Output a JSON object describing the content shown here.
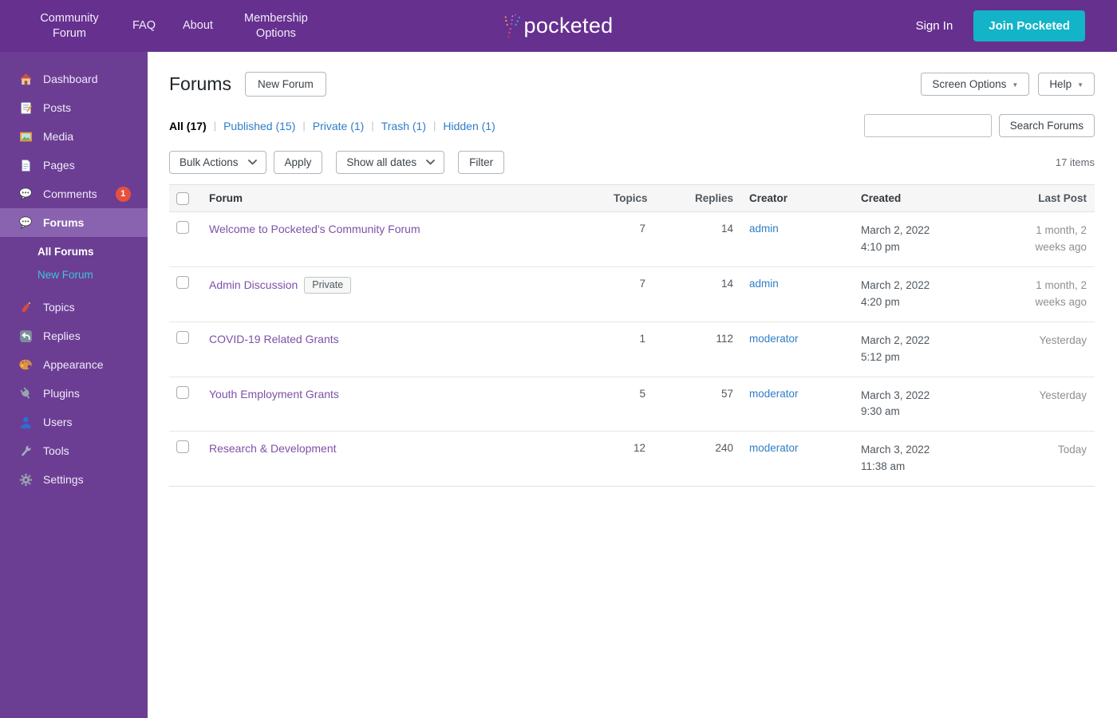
{
  "colors": {
    "topbar_purple": "#66308f",
    "sidebar_purple": "#6b3e94",
    "active_item_purple": "#8a63b0",
    "accent_teal": "#14b4c8",
    "link_blue": "#2f7ec7",
    "link_purple": "#7d51a8",
    "badge_red": "#e8503c"
  },
  "topbar": {
    "nav": [
      {
        "label": "Community Forum"
      },
      {
        "label": "FAQ"
      },
      {
        "label": "About"
      },
      {
        "label": "Membership Options"
      }
    ],
    "logo_text": "pocketed",
    "sign_in": "Sign In",
    "join_button": "Join Pocketed"
  },
  "sidebar": {
    "items": [
      {
        "label": "Dashboard"
      },
      {
        "label": "Posts"
      },
      {
        "label": "Media"
      },
      {
        "label": "Pages"
      },
      {
        "label": "Comments",
        "badge": "1"
      },
      {
        "label": "Forums"
      },
      {
        "label": "Topics"
      },
      {
        "label": "Replies"
      },
      {
        "label": "Appearance"
      },
      {
        "label": "Plugins"
      },
      {
        "label": "Users"
      },
      {
        "label": "Tools"
      },
      {
        "label": "Settings"
      }
    ],
    "forums_submenu": [
      {
        "label": "All Forums"
      },
      {
        "label": "New Forum"
      }
    ]
  },
  "page": {
    "title": "Forums",
    "new_forum_button": "New Forum",
    "screen_options": "Screen Options",
    "help": "Help",
    "caret": "▼"
  },
  "filters": {
    "all": "All (17)",
    "published": "Published (15)",
    "private": "Private (1)",
    "trash": "Trash (1)",
    "hidden": "Hidden (1)"
  },
  "search": {
    "value": "",
    "button": "Search Forums"
  },
  "toolbar": {
    "bulk_actions": "Bulk Actions",
    "apply": "Apply",
    "show_dates": "Show all dates",
    "filter": "Filter",
    "items_count": "17 items"
  },
  "table": {
    "headers": {
      "forum": "Forum",
      "topics": "Topics",
      "replies": "Replies",
      "creator": "Creator",
      "created": "Created",
      "last_post": "Last Post"
    },
    "rows": [
      {
        "forum": "Welcome to Pocketed's Community Forum",
        "badge": null,
        "topics": 7,
        "replies": 14,
        "creator": "admin",
        "created_date": "March 2, 2022",
        "created_time": "4:10 pm",
        "last_post": "1 month, 2 weeks ago"
      },
      {
        "forum": "Admin Discussion",
        "badge": "Private",
        "topics": 7,
        "replies": 14,
        "creator": "admin",
        "created_date": "March 2, 2022",
        "created_time": "4:20 pm",
        "last_post": "1 month, 2 weeks ago"
      },
      {
        "forum": "COVID-19 Related Grants",
        "badge": null,
        "topics": 1,
        "replies": 112,
        "creator": "moderator",
        "created_date": "March 2, 2022",
        "created_time": "5:12 pm",
        "last_post": "Yesterday"
      },
      {
        "forum": "Youth Employment Grants",
        "badge": null,
        "topics": 5,
        "replies": 57,
        "creator": "moderator",
        "created_date": "March 3, 2022",
        "created_time": "9:30 am",
        "last_post": "Yesterday"
      },
      {
        "forum": "Research & Development",
        "badge": null,
        "topics": 12,
        "replies": 240,
        "creator": "moderator",
        "created_date": "March 3, 2022",
        "created_time": "11:38 am",
        "last_post": "Today"
      }
    ]
  }
}
